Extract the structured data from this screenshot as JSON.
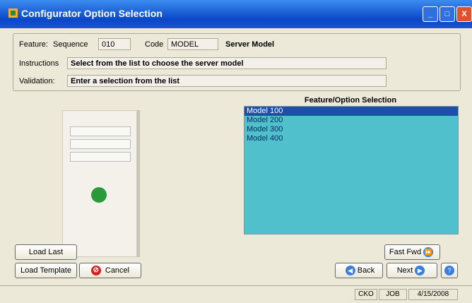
{
  "window": {
    "title": "Configurator Option Selection",
    "min_label": "_",
    "max_label": "□",
    "close_label": "X"
  },
  "header": {
    "feature_label": "Feature:",
    "sequence_label": "Sequence",
    "sequence_value": "010",
    "code_label": "Code",
    "code_value": "MODEL",
    "feature_name": "Server Model",
    "instructions_label": "Instructions",
    "instructions_value": "Select from the list to choose the server model",
    "validation_label": "Validation:",
    "validation_value": "Enter a selection from the list"
  },
  "options": {
    "title": "Feature/Option Selection",
    "items": [
      "Model 100",
      "Model 200",
      "Model 300",
      "Model 400"
    ],
    "selected_index": 0
  },
  "buttons": {
    "load_last": "Load Last",
    "load_template": "Load Template",
    "cancel": "Cancel",
    "fast_fwd": "Fast Fwd",
    "back": "Back",
    "next": "Next"
  },
  "status": {
    "user": "CKO",
    "module": "JOB",
    "date": "4/15/2008"
  },
  "colors": {
    "title_bar": "#1b5fd6",
    "list_bg": "#4fc0cc",
    "list_selection": "#1d4fa8"
  }
}
